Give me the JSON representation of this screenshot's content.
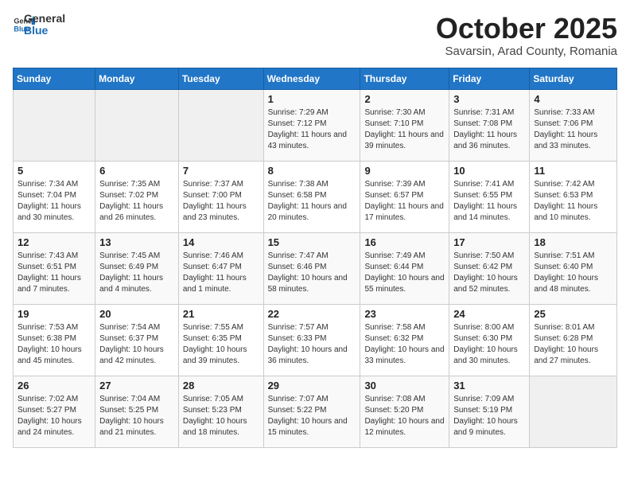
{
  "header": {
    "logo_general": "General",
    "logo_blue": "Blue",
    "month_title": "October 2025",
    "subtitle": "Savarsin, Arad County, Romania"
  },
  "weekdays": [
    "Sunday",
    "Monday",
    "Tuesday",
    "Wednesday",
    "Thursday",
    "Friday",
    "Saturday"
  ],
  "weeks": [
    [
      {
        "day": "",
        "info": ""
      },
      {
        "day": "",
        "info": ""
      },
      {
        "day": "",
        "info": ""
      },
      {
        "day": "1",
        "info": "Sunrise: 7:29 AM\nSunset: 7:12 PM\nDaylight: 11 hours and 43 minutes."
      },
      {
        "day": "2",
        "info": "Sunrise: 7:30 AM\nSunset: 7:10 PM\nDaylight: 11 hours and 39 minutes."
      },
      {
        "day": "3",
        "info": "Sunrise: 7:31 AM\nSunset: 7:08 PM\nDaylight: 11 hours and 36 minutes."
      },
      {
        "day": "4",
        "info": "Sunrise: 7:33 AM\nSunset: 7:06 PM\nDaylight: 11 hours and 33 minutes."
      }
    ],
    [
      {
        "day": "5",
        "info": "Sunrise: 7:34 AM\nSunset: 7:04 PM\nDaylight: 11 hours and 30 minutes."
      },
      {
        "day": "6",
        "info": "Sunrise: 7:35 AM\nSunset: 7:02 PM\nDaylight: 11 hours and 26 minutes."
      },
      {
        "day": "7",
        "info": "Sunrise: 7:37 AM\nSunset: 7:00 PM\nDaylight: 11 hours and 23 minutes."
      },
      {
        "day": "8",
        "info": "Sunrise: 7:38 AM\nSunset: 6:58 PM\nDaylight: 11 hours and 20 minutes."
      },
      {
        "day": "9",
        "info": "Sunrise: 7:39 AM\nSunset: 6:57 PM\nDaylight: 11 hours and 17 minutes."
      },
      {
        "day": "10",
        "info": "Sunrise: 7:41 AM\nSunset: 6:55 PM\nDaylight: 11 hours and 14 minutes."
      },
      {
        "day": "11",
        "info": "Sunrise: 7:42 AM\nSunset: 6:53 PM\nDaylight: 11 hours and 10 minutes."
      }
    ],
    [
      {
        "day": "12",
        "info": "Sunrise: 7:43 AM\nSunset: 6:51 PM\nDaylight: 11 hours and 7 minutes."
      },
      {
        "day": "13",
        "info": "Sunrise: 7:45 AM\nSunset: 6:49 PM\nDaylight: 11 hours and 4 minutes."
      },
      {
        "day": "14",
        "info": "Sunrise: 7:46 AM\nSunset: 6:47 PM\nDaylight: 11 hours and 1 minute."
      },
      {
        "day": "15",
        "info": "Sunrise: 7:47 AM\nSunset: 6:46 PM\nDaylight: 10 hours and 58 minutes."
      },
      {
        "day": "16",
        "info": "Sunrise: 7:49 AM\nSunset: 6:44 PM\nDaylight: 10 hours and 55 minutes."
      },
      {
        "day": "17",
        "info": "Sunrise: 7:50 AM\nSunset: 6:42 PM\nDaylight: 10 hours and 52 minutes."
      },
      {
        "day": "18",
        "info": "Sunrise: 7:51 AM\nSunset: 6:40 PM\nDaylight: 10 hours and 48 minutes."
      }
    ],
    [
      {
        "day": "19",
        "info": "Sunrise: 7:53 AM\nSunset: 6:38 PM\nDaylight: 10 hours and 45 minutes."
      },
      {
        "day": "20",
        "info": "Sunrise: 7:54 AM\nSunset: 6:37 PM\nDaylight: 10 hours and 42 minutes."
      },
      {
        "day": "21",
        "info": "Sunrise: 7:55 AM\nSunset: 6:35 PM\nDaylight: 10 hours and 39 minutes."
      },
      {
        "day": "22",
        "info": "Sunrise: 7:57 AM\nSunset: 6:33 PM\nDaylight: 10 hours and 36 minutes."
      },
      {
        "day": "23",
        "info": "Sunrise: 7:58 AM\nSunset: 6:32 PM\nDaylight: 10 hours and 33 minutes."
      },
      {
        "day": "24",
        "info": "Sunrise: 8:00 AM\nSunset: 6:30 PM\nDaylight: 10 hours and 30 minutes."
      },
      {
        "day": "25",
        "info": "Sunrise: 8:01 AM\nSunset: 6:28 PM\nDaylight: 10 hours and 27 minutes."
      }
    ],
    [
      {
        "day": "26",
        "info": "Sunrise: 7:02 AM\nSunset: 5:27 PM\nDaylight: 10 hours and 24 minutes."
      },
      {
        "day": "27",
        "info": "Sunrise: 7:04 AM\nSunset: 5:25 PM\nDaylight: 10 hours and 21 minutes."
      },
      {
        "day": "28",
        "info": "Sunrise: 7:05 AM\nSunset: 5:23 PM\nDaylight: 10 hours and 18 minutes."
      },
      {
        "day": "29",
        "info": "Sunrise: 7:07 AM\nSunset: 5:22 PM\nDaylight: 10 hours and 15 minutes."
      },
      {
        "day": "30",
        "info": "Sunrise: 7:08 AM\nSunset: 5:20 PM\nDaylight: 10 hours and 12 minutes."
      },
      {
        "day": "31",
        "info": "Sunrise: 7:09 AM\nSunset: 5:19 PM\nDaylight: 10 hours and 9 minutes."
      },
      {
        "day": "",
        "info": ""
      }
    ]
  ]
}
